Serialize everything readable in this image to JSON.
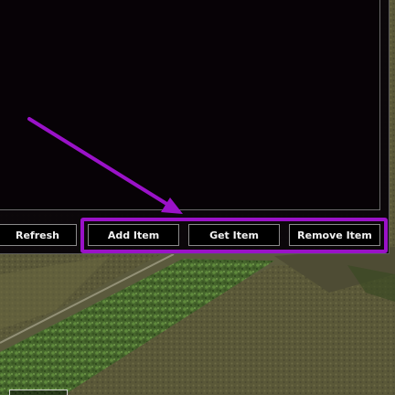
{
  "buttons": {
    "refresh": "Refresh",
    "add_item": "Add Item",
    "get_item": "Get Item",
    "remove_item": "Remove Item"
  },
  "annotation": {
    "color": "#9a12c8"
  },
  "colors": {
    "panel_bg": "#070206",
    "button_bg": "#000000",
    "button_text": "#f2f2f2",
    "hedge_green": "#4f6e33",
    "grass": "#5c5a3a"
  }
}
